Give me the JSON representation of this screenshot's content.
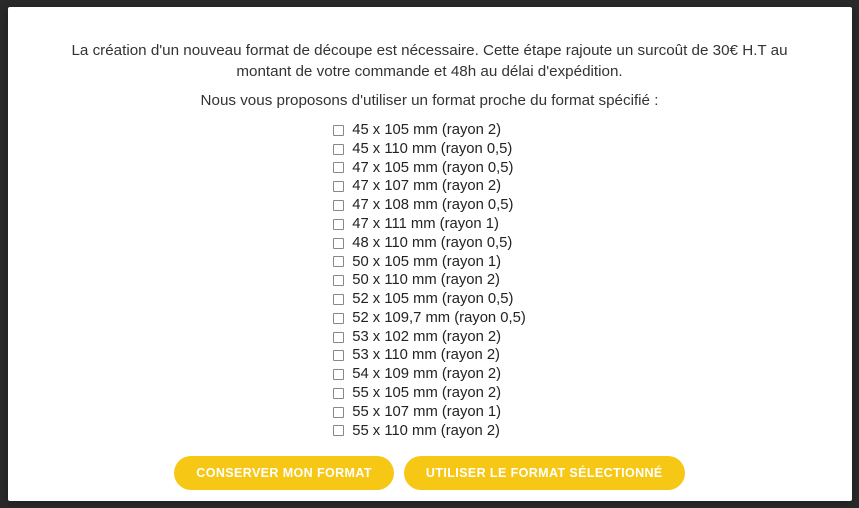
{
  "modal": {
    "warning": "La création d'un nouveau format de découpe est nécessaire. Cette étape rajoute un surcoût de 30€ H.T au montant de votre commande et 48h au délai d'expédition.",
    "suggestion": "Nous vous proposons d'utiliser un format proche du format spécifié :",
    "formats": [
      "45 x 105 mm (rayon 2)",
      "45 x 110 mm (rayon 0,5)",
      "47 x 105 mm (rayon 0,5)",
      "47 x 107 mm (rayon 2)",
      "47 x 108 mm (rayon 0,5)",
      "47 x 111 mm (rayon 1)",
      "48 x 110 mm (rayon 0,5)",
      "50 x 105 mm (rayon 1)",
      "50 x 110 mm (rayon 2)",
      "52 x 105 mm (rayon 0,5)",
      "52 x 109,7 mm (rayon 0,5)",
      "53 x 102 mm (rayon 2)",
      "53 x 110 mm (rayon 2)",
      "54 x 109 mm (rayon 2)",
      "55 x 105 mm (rayon 2)",
      "55 x 107 mm (rayon 1)",
      "55 x 110 mm (rayon 2)"
    ],
    "buttons": {
      "keep": "CONSERVER MON FORMAT",
      "use": "UTILISER LE FORMAT SÉLECTIONNÉ"
    }
  }
}
